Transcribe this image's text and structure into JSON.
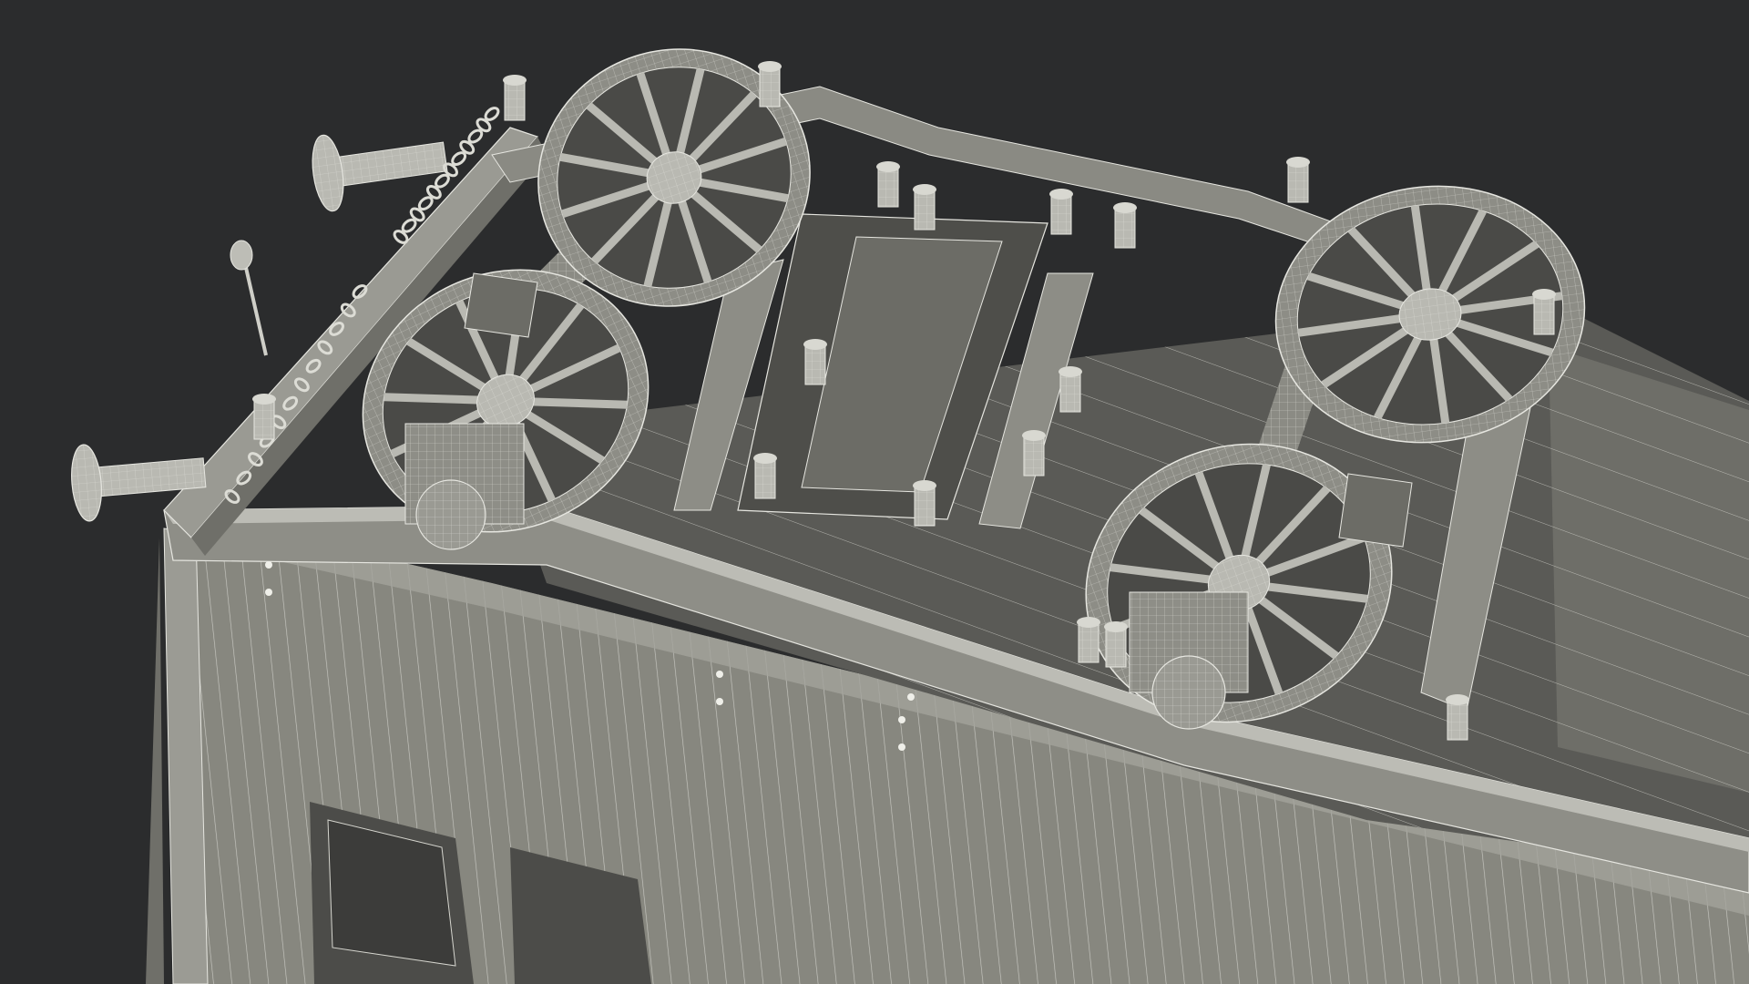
{
  "scene": {
    "background_color": "#2b2c2d",
    "model_color": "#8d8d86",
    "model_shadow_color": "#4a4a47",
    "model_light_color": "#b9b9b2",
    "wire_color": "#e6e6e0",
    "wheel_count": 4,
    "spokes_per_wheel": 12,
    "buffer_count": 2,
    "chain_count": 2
  }
}
